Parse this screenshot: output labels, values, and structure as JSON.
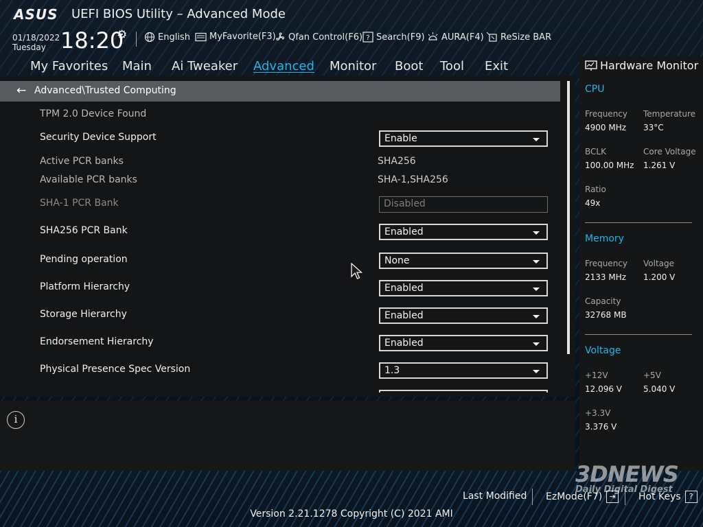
{
  "header": {
    "logo": "ASUS",
    "title": "UEFI BIOS Utility – Advanced Mode",
    "date": "01/18/2022",
    "weekday": "Tuesday",
    "time": "18:20",
    "tools": [
      {
        "label": "English",
        "icon": "globe-icon"
      },
      {
        "label": "MyFavorite(F3)",
        "icon": "favorite-icon"
      },
      {
        "label": "Qfan Control(F6)",
        "icon": "fan-icon"
      },
      {
        "label": "Search(F9)",
        "icon": "search-icon"
      },
      {
        "label": "AURA(F4)",
        "icon": "aura-icon"
      },
      {
        "label": "ReSize BAR",
        "icon": "resize-bar-icon"
      }
    ]
  },
  "nav": {
    "tabs": [
      "My Favorites",
      "Main",
      "Ai Tweaker",
      "Advanced",
      "Monitor",
      "Boot",
      "Tool",
      "Exit"
    ],
    "active": "Advanced"
  },
  "breadcrumb": "Advanced\\Trusted Computing",
  "settings": {
    "tpm_found": "TPM 2.0 Device Found",
    "security_device_support": {
      "label": "Security Device Support",
      "value": "Enable"
    },
    "active_pcr": {
      "label": "Active PCR banks",
      "value": "SHA256"
    },
    "available_pcr": {
      "label": "Available PCR banks",
      "value": "SHA-1,SHA256"
    },
    "sha1_pcr": {
      "label": "SHA-1 PCR Bank",
      "value": "Disabled"
    },
    "sha256_pcr": {
      "label": "SHA256 PCR Bank",
      "value": "Enabled"
    },
    "pending_operation": {
      "label": "Pending operation",
      "value": "None"
    },
    "platform_hierarchy": {
      "label": "Platform Hierarchy",
      "value": "Enabled"
    },
    "storage_hierarchy": {
      "label": "Storage Hierarchy",
      "value": "Enabled"
    },
    "endorsement_hierarchy": {
      "label": "Endorsement Hierarchy",
      "value": "Enabled"
    },
    "pp_spec_version": {
      "label": "Physical Presence Spec Version",
      "value": "1.3"
    }
  },
  "hardware_monitor": {
    "title": "Hardware Monitor",
    "cpu": {
      "title": "CPU",
      "frequency_label": "Frequency",
      "frequency": "4900 MHz",
      "temperature_label": "Temperature",
      "temperature": "33°C",
      "bclk_label": "BCLK",
      "bclk": "100.00 MHz",
      "core_voltage_label": "Core Voltage",
      "core_voltage": "1.261 V",
      "ratio_label": "Ratio",
      "ratio": "49x"
    },
    "memory": {
      "title": "Memory",
      "frequency_label": "Frequency",
      "frequency": "2133 MHz",
      "voltage_label": "Voltage",
      "voltage": "1.200 V",
      "capacity_label": "Capacity",
      "capacity": "32768 MB"
    },
    "voltage": {
      "title": "Voltage",
      "v12_label": "+12V",
      "v12": "12.096 V",
      "v5_label": "+5V",
      "v5": "5.040 V",
      "v33_label": "+3.3V",
      "v33": "3.376 V"
    }
  },
  "footer": {
    "last_modified": "Last Modified",
    "ezmode": "EzMode(F7)",
    "hotkeys": "Hot Keys",
    "hotkeys_key": "?",
    "version": "Version 2.21.1278 Copyright (C) 2021 AMI"
  },
  "watermark": {
    "brand": "3DNEWS",
    "tagline": "Daily Digital Digest"
  },
  "colors": {
    "accent": "#1fb6e8",
    "panel": "#131517",
    "breadcrumb": "#585b5e"
  }
}
